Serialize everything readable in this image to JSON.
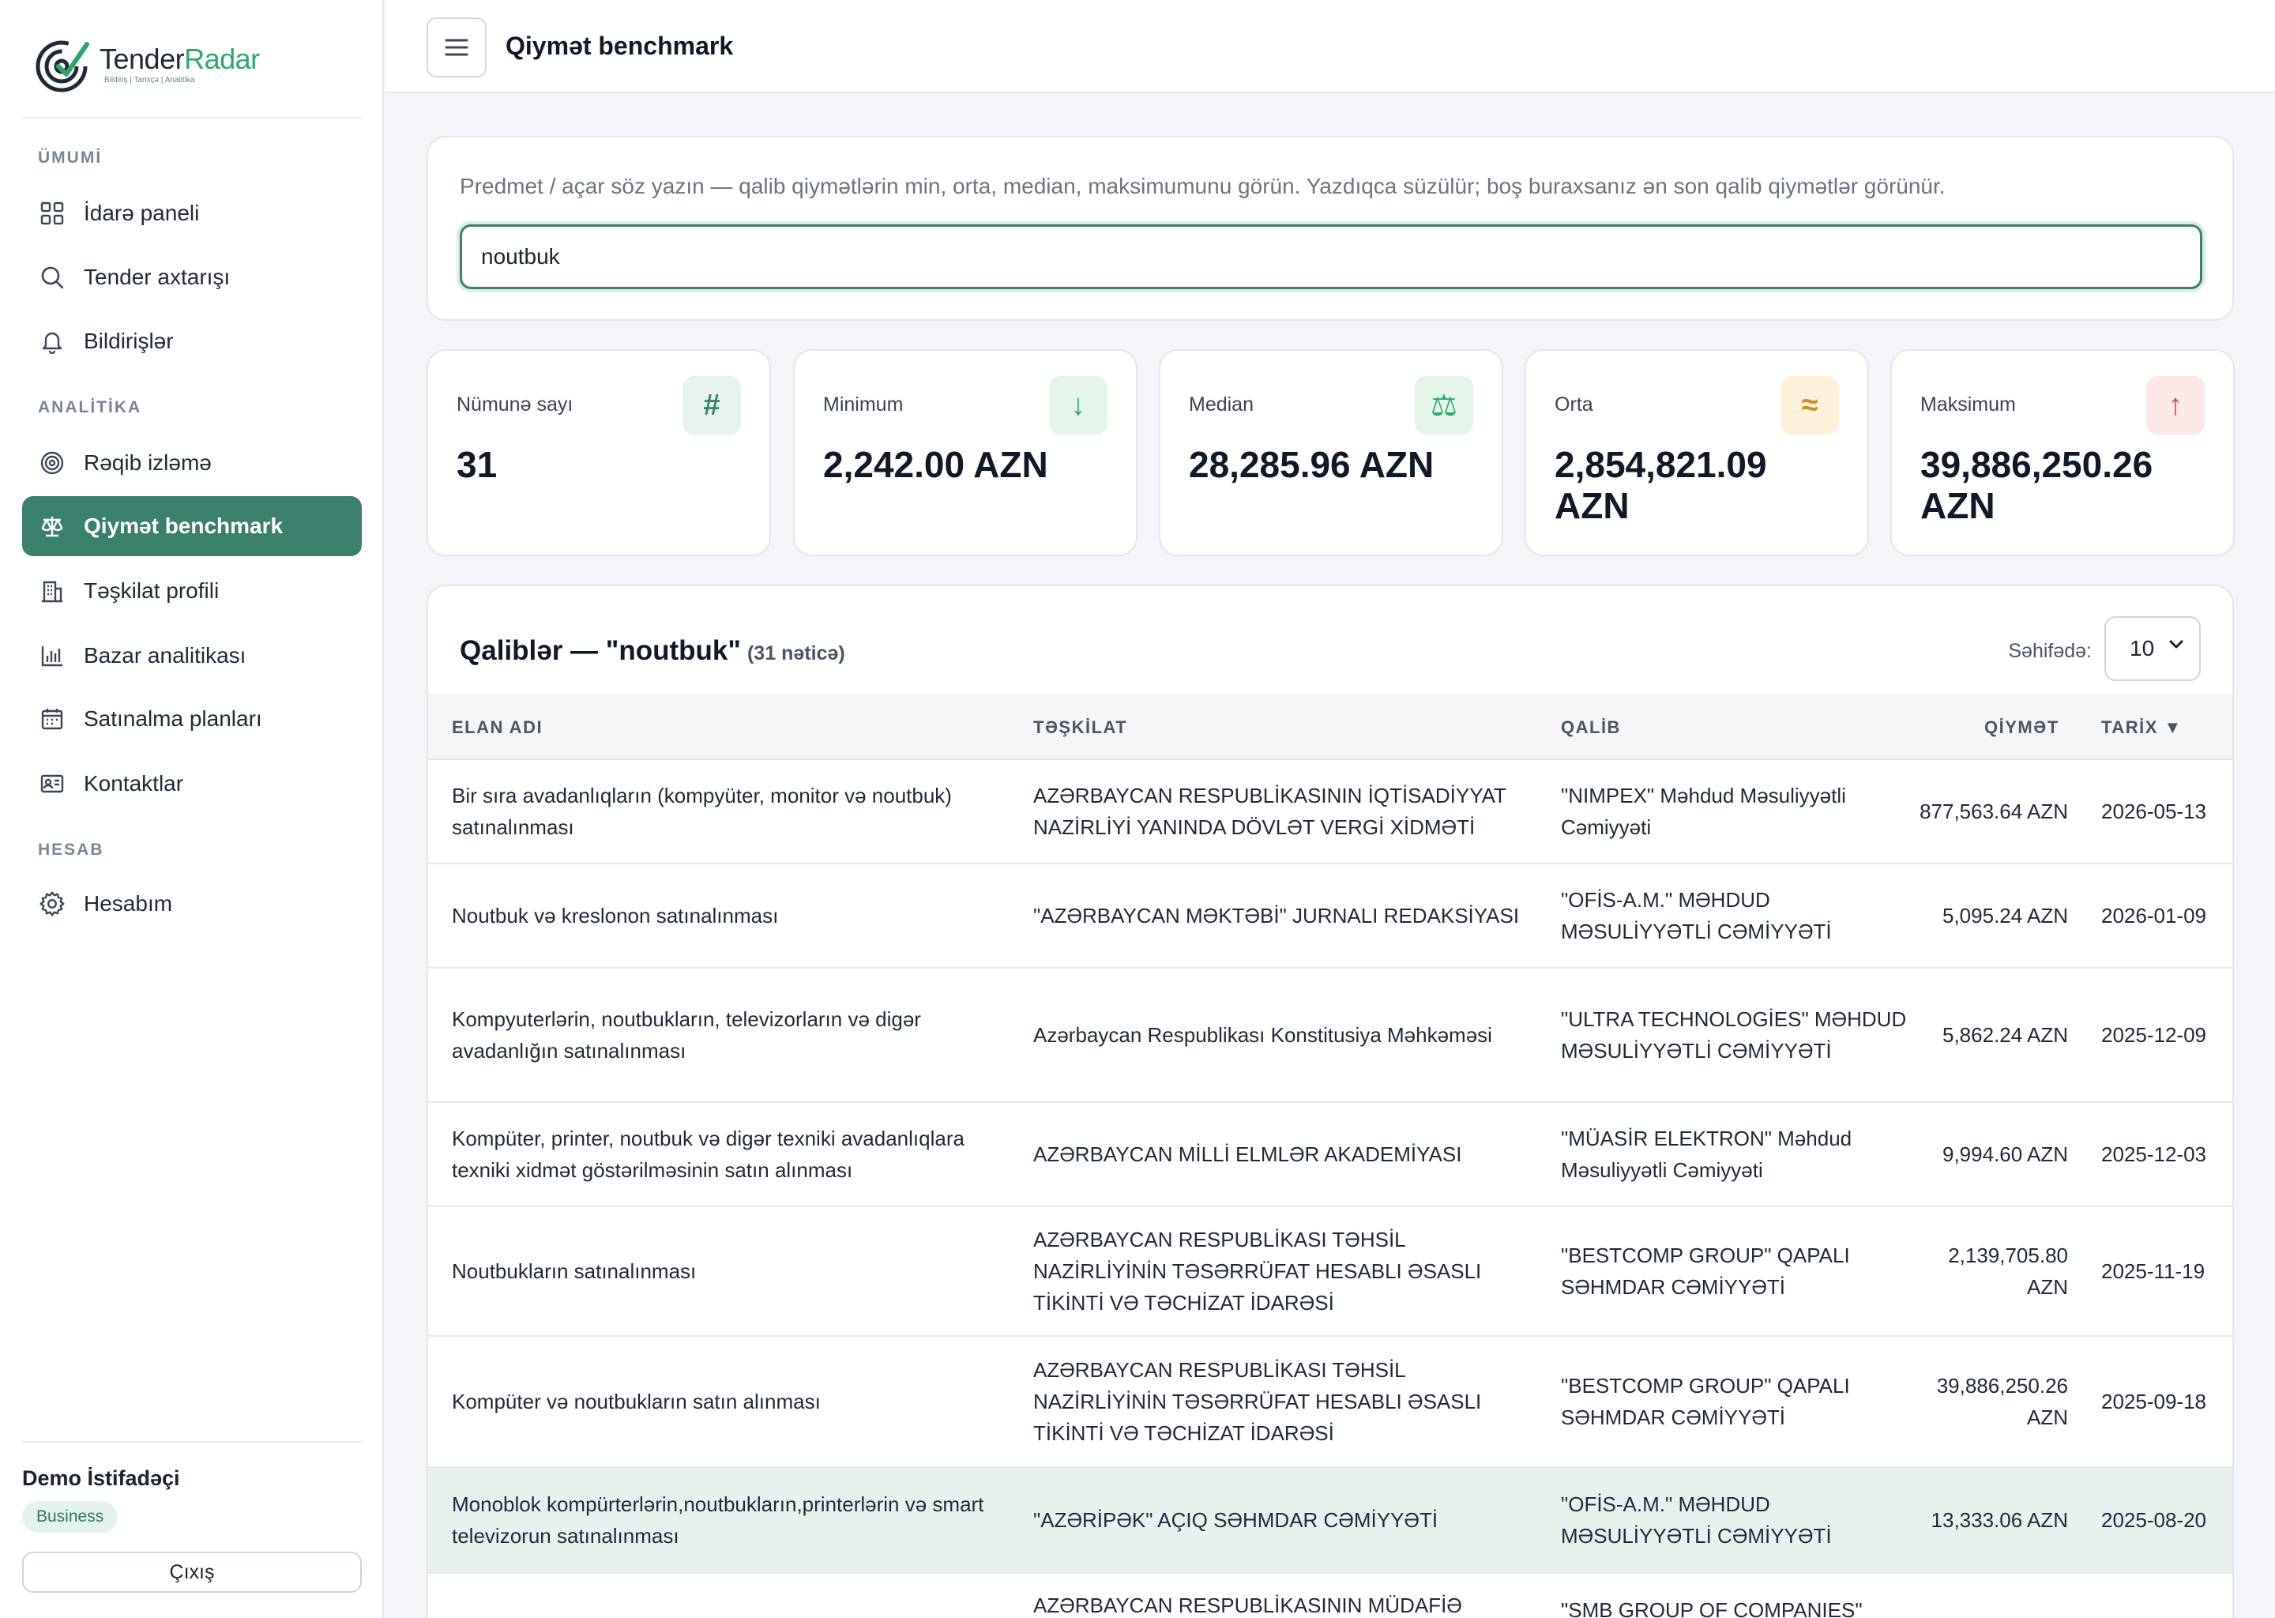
{
  "brand": {
    "name_part1": "Tender",
    "name_part2": "Radar",
    "tagline": "Bildiriş | Tarixçə | Analitika",
    "accent": "#2fa66a"
  },
  "sidebar": {
    "sections": [
      {
        "label": "ÜMUMİ"
      },
      {
        "label": "ANALİTİKA"
      },
      {
        "label": "HESAB"
      }
    ],
    "items": [
      {
        "label": "İdarə paneli",
        "icon": "grid-icon"
      },
      {
        "label": "Tender axtarışı",
        "icon": "search-icon"
      },
      {
        "label": "Bildirişlər",
        "icon": "bell-icon"
      },
      {
        "label": "Rəqib izləmə",
        "icon": "target-icon"
      },
      {
        "label": "Qiymət benchmark",
        "icon": "scale-icon",
        "active": true
      },
      {
        "label": "Təşkilat profili",
        "icon": "building-icon"
      },
      {
        "label": "Bazar analitikası",
        "icon": "bar-chart-icon"
      },
      {
        "label": "Satınalma planları",
        "icon": "calendar-icon"
      },
      {
        "label": "Kontaktlar",
        "icon": "contact-card-icon"
      },
      {
        "label": "Hesabım",
        "icon": "gear-icon"
      }
    ],
    "user": {
      "name": "Demo İstifadəçi",
      "plan": "Business"
    },
    "logout_label": "Çıxış",
    "active_color": "#3b7f6d"
  },
  "header": {
    "title": "Qiymət benchmark"
  },
  "search": {
    "help": "Predmet / açar söz yazın — qalib qiymətlərin min, orta, median, maksimumunu görün. Yazdıqca süzülür; boş buraxsanız ən son qalib qiymətlər görünür.",
    "value": "noutbuk"
  },
  "stats": [
    {
      "label": "Nümunə sayı",
      "value": "31",
      "icon": "hash-icon",
      "symbol": "#",
      "bg": "#e6f3ee",
      "fg": "#3b7f6d"
    },
    {
      "label": "Minimum",
      "value": "2,242.00 AZN",
      "icon": "arrow-down-icon",
      "symbol": "↓",
      "bg": "#e4f5ea",
      "fg": "#2fa66a"
    },
    {
      "label": "Median",
      "value": "28,285.96 AZN",
      "icon": "scale-icon",
      "symbol": "⚖",
      "bg": "#e4f5ea",
      "fg": "#2fa66a"
    },
    {
      "label": "Orta",
      "value": "2,854,821.09 AZN",
      "icon": "approx-icon",
      "symbol": "≈",
      "bg": "#fdf1dc",
      "fg": "#d08a1c"
    },
    {
      "label": "Maksimum",
      "value": "39,886,250.26 AZN",
      "icon": "arrow-up-icon",
      "symbol": "↑",
      "bg": "#fde8e8",
      "fg": "#e0474c"
    }
  ],
  "results": {
    "title": "Qaliblər — \"noutbuk\"",
    "count": "(31 nəticə)",
    "per_page_label": "Səhifədə:",
    "per_page": "10",
    "columns": {
      "name": "ELAN ADI",
      "org": "TƏŞKİLAT",
      "winner": "QALİB",
      "price": "QİYMƏT",
      "date": "TARİX ▼"
    },
    "rows": [
      {
        "name": "Bir sıra avadanlıqların (kompyüter, monitor və noutbuk) satınalınması",
        "org": "AZƏRBAYCAN RESPUBLİKASININ İQTİSADİYYAT NAZİRLİYİ YANINDA DÖVLƏT VERGİ XİDMƏTİ",
        "winner": "\"NIMPEX\" Məhdud Məsuliyyətli Cəmiyyəti",
        "price": "877,563.64 AZN",
        "date": "2026-05-13"
      },
      {
        "name": "Noutbuk və kreslonon satınalınması",
        "org": "\"AZƏRBAYCAN MƏKTƏBİ\" JURNALI REDAKSİYASI",
        "winner": "\"OFİS-A.M.\" MƏHDUD MƏSULİYYƏTLİ CƏMİYYƏTİ",
        "price": "5,095.24 AZN",
        "date": "2026-01-09"
      },
      {
        "name": "Kompyuterlərin, noutbukların, televizorların və digər avadanlığın satınalınması",
        "org": "Azərbaycan Respublikası Konstitusiya Məhkəməsi",
        "winner": "\"ULTRA TECHNOLOGİES\" MƏHDUD MƏSULİYYƏTLİ CƏMİYYƏTİ",
        "price": "5,862.24 AZN",
        "date": "2025-12-09"
      },
      {
        "name": "Kompüter, printer, noutbuk və digər texniki avadanlıqlara texniki xidmət göstərilməsinin satın alınması",
        "org": "AZƏRBAYCAN MİLLİ ELMLƏR AKADEMİYASI",
        "winner": "\"MÜASİR ELEKTRON\" Məhdud Məsuliyyətli Cəmiyyəti",
        "price": "9,994.60 AZN",
        "date": "2025-12-03"
      },
      {
        "name": "Noutbukların satınalınması",
        "org": "AZƏRBAYCAN RESPUBLİKASI TƏHSİL NAZİRLİYİNİN TƏSƏRRÜFAT HESABLI ƏSASLI TİKİNTİ VƏ TƏCHİZAT İDARƏSİ",
        "winner": "\"BESTCOMP GROUP\" QAPALI SƏHMDAR CƏMİYYƏTİ",
        "price": "2,139,705.80 AZN",
        "date": "2025-11-19"
      },
      {
        "name": "Kompüter və noutbukların satın alınması",
        "org": "AZƏRBAYCAN RESPUBLİKASI TƏHSİL NAZİRLİYİNİN TƏSƏRRÜFAT HESABLI ƏSASLI TİKİNTİ VƏ TƏCHİZAT İDARƏSİ",
        "winner": "\"BESTCOMP GROUP\" QAPALI SƏHMDAR CƏMİYYƏTİ",
        "price": "39,886,250.26 AZN",
        "date": "2025-09-18"
      },
      {
        "name": "Monoblok kompürterlərin,noutbukların,printerlərin və smart televizorun satınalınması",
        "org": "\"AZƏRİPƏK\" AÇIQ SƏHMDAR CƏMİYYƏTİ",
        "winner": "\"OFİS-A.M.\" MƏHDUD MƏSULİYYƏTLİ CƏMİYYƏTİ",
        "price": "13,333.06 AZN",
        "date": "2025-08-20"
      },
      {
        "name": "",
        "org": "AZƏRBAYCAN RESPUBLİKASININ MÜDAFİƏ SƏNAYESİ",
        "winner": "\"SMB GROUP OF COMPANIES\"",
        "price": "",
        "date": ""
      }
    ]
  }
}
